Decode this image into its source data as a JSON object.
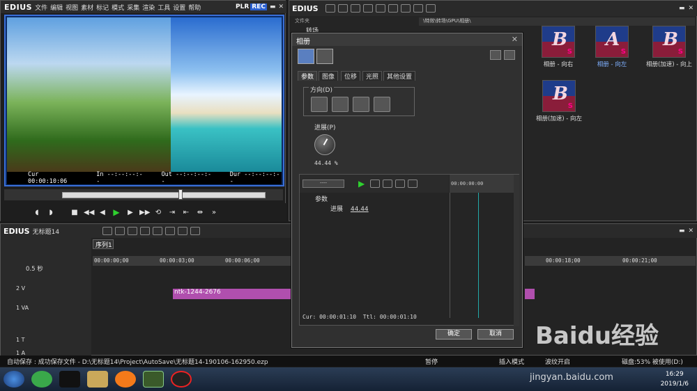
{
  "player": {
    "app_name": "EDIUS",
    "menu": [
      "文件",
      "编辑",
      "视图",
      "素材",
      "标记",
      "模式",
      "采集",
      "渲染",
      "工具",
      "设置",
      "帮助"
    ],
    "plr": "PLR",
    "rec": "REC",
    "status": {
      "cur": "Cur 00:00:10:06",
      "in": "In --:--:--:--",
      "out": "Out --:--:--:--",
      "dur": "Dur --:--:--:--"
    }
  },
  "bin": {
    "app_name": "EDIUS",
    "folder_header": "文件夹",
    "folder_item": "转场",
    "path": "\\特效\\转场\\GPU\\相册\\",
    "clips": [
      {
        "label": "相册 - 向右"
      },
      {
        "label": "相册 - 向左"
      },
      {
        "label": "相册(加速) - 向上"
      },
      {
        "label": "相册(加速) - 向左"
      }
    ]
  },
  "dialog": {
    "title": "相册",
    "tabs": [
      "参数",
      "图像",
      "位移",
      "光照",
      "其他设置"
    ],
    "direction_label": "方向(D)",
    "progress_label": "进展(P)",
    "progress_value": "44.44 %",
    "progress_percent": 44.44,
    "kf_time_dropdown": "----",
    "kf_ruler": "00:00:00:00",
    "kf_rows": [
      {
        "label": "参数"
      },
      {
        "label": "进展",
        "value": "44.44"
      }
    ],
    "cur": "Cur: 00:00:01:10",
    "ttl": "Ttl: 00:00:01:10",
    "ok": "确定",
    "cancel": "取消"
  },
  "edit": {
    "app_name": "EDIUS",
    "project_name": "无标题14",
    "sequence_tab": "序列1",
    "zoom": "0.5 秒",
    "tracks": [
      "2 V",
      "1 VA",
      "1 T",
      "1 A"
    ],
    "ruler_labels": [
      "00:00:00;00",
      "00:00:03;00",
      "00:00:06;00"
    ],
    "ruler_labels_right": [
      "00:00:18;00",
      "00:00:21;00"
    ],
    "clip_name": "ntk-1244-2676"
  },
  "statusbar": {
    "autosave": "自动保存 : 成功保存文件 - D:\\无标题14\\Project\\AutoSave\\无标题14-190106-162950.ezp",
    "pause": "暂停",
    "insert_mode": "插入模式",
    "ripple": "波纹开启",
    "disk": "磁盘:53% 被使用(D:)"
  },
  "taskbar": {
    "time": "16:29",
    "date": "2019/1/6"
  },
  "watermark": {
    "brand": "Baidu经验",
    "url": "jingyan.baidu.com"
  }
}
